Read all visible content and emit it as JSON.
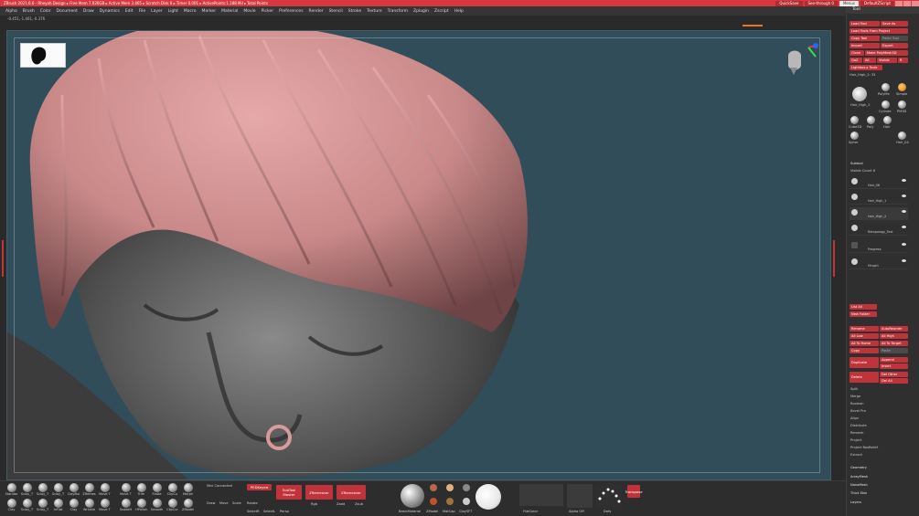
{
  "titlebar": {
    "title": "ZBrush 2021.6.6 - Rheyah Design ▸ Free Mem 7.026GB ▸ Active Mem 3.465 ▸ Scratch Disk 0 ▸ Timer 0.001 ▸ ActivePoints:1.188 Mil ▸ Total Points",
    "buttons": [
      "QuickSave",
      "See-through 0",
      "Menus",
      "DefaultZScript"
    ]
  },
  "menu": [
    "Alpha",
    "Brush",
    "Color",
    "Document",
    "Draw",
    "Dynamics",
    "Edit",
    "File",
    "Layer",
    "Light",
    "Macro",
    "Marker",
    "Material",
    "Movie",
    "Picker",
    "Preferences",
    "Render",
    "Stencil",
    "Stroke",
    "Texture",
    "Transform",
    "Zplugin",
    "Zscript",
    "Help"
  ],
  "coords": "-0.451,-1.461,-0.376",
  "bottom": {
    "brushes_top": [
      "Standar",
      "Sclay_T",
      "Sclay_T",
      "Sclay_T",
      "ClayBui",
      "ZRemes",
      "Move T",
      "Move T",
      "Trim",
      "Flatte",
      "ClipCu",
      "Morph"
    ],
    "brushes_bottom": [
      "Clay",
      "Sclay_T",
      "Sclay_T",
      "InFlat",
      "Clay",
      "Wrinkle",
      "Move T",
      "SnakeH",
      "HPolish",
      "Smooth",
      "ClipCur",
      "ZModel"
    ],
    "mini_connected": "Mini Connected",
    "buttons": [
      "PEDKeyed",
      "SubTool Master",
      "ZRemesher",
      "ZRemesher",
      "Transpose"
    ],
    "labels": [
      "Draw",
      "Move",
      "Scale",
      "Rotate",
      "Rgb",
      "Zadd",
      "Zsub",
      "SelectR",
      "SelectL",
      "Persp"
    ],
    "material_labels": [
      "BasicMaterial",
      "ZModel",
      "MatCap",
      "ClaySFT",
      "FlatColor",
      "Alpha Off",
      "Dots"
    ]
  },
  "tool_panel": {
    "header": "Tool",
    "buttons": [
      [
        "Load Tool",
        "Save As"
      ],
      [
        "Load Tools From Project",
        ""
      ],
      [
        "Copy Tool",
        "Paste Tool"
      ],
      [
        "Import",
        "Export"
      ],
      [
        "Clone",
        "Make PolyMesh3D"
      ],
      [
        "GoZ",
        "All",
        "Visible",
        "R"
      ],
      [
        "Lightbox ▸ Tools",
        ""
      ]
    ],
    "current_tool": "Hair_High_2: 33",
    "tool_icons": [
      "Hair_High_2",
      "PolyMe",
      "Simple",
      "Cylinde",
      "PM3D",
      "Cube3D",
      "Poly",
      "Hair",
      "Spher",
      "Hair_04"
    ],
    "subtool_header": "Subtool",
    "visible_count": "Visible Count 8",
    "subtools": [
      "Hair_06",
      "Hair_High_1",
      "Hair_High_2",
      "Retopology_Test",
      "Progress",
      "Hinge1"
    ],
    "ops": [
      [
        "List All",
        ""
      ],
      [
        "New Folder",
        ""
      ],
      [
        "Rename",
        "AutoReorder"
      ],
      [
        "All Low",
        "All High"
      ],
      [
        "All To Home",
        "All To Target"
      ],
      [
        "Copy",
        "Paste"
      ],
      [
        "Duplicate",
        "Append"
      ],
      [
        "",
        "Insert"
      ],
      [
        "Delete",
        "Del Other"
      ],
      [
        "",
        "Del All"
      ]
    ],
    "list": [
      "Split",
      "Merge",
      "Boolean",
      "Bevel Pro",
      "Align",
      "Distribute",
      "Remesh",
      "Project",
      "Project BasRelief",
      "Extract"
    ],
    "sections": [
      "Geometry",
      "ArrayMesh",
      "NanoMesh",
      "Thick Skin",
      "Layers"
    ]
  }
}
